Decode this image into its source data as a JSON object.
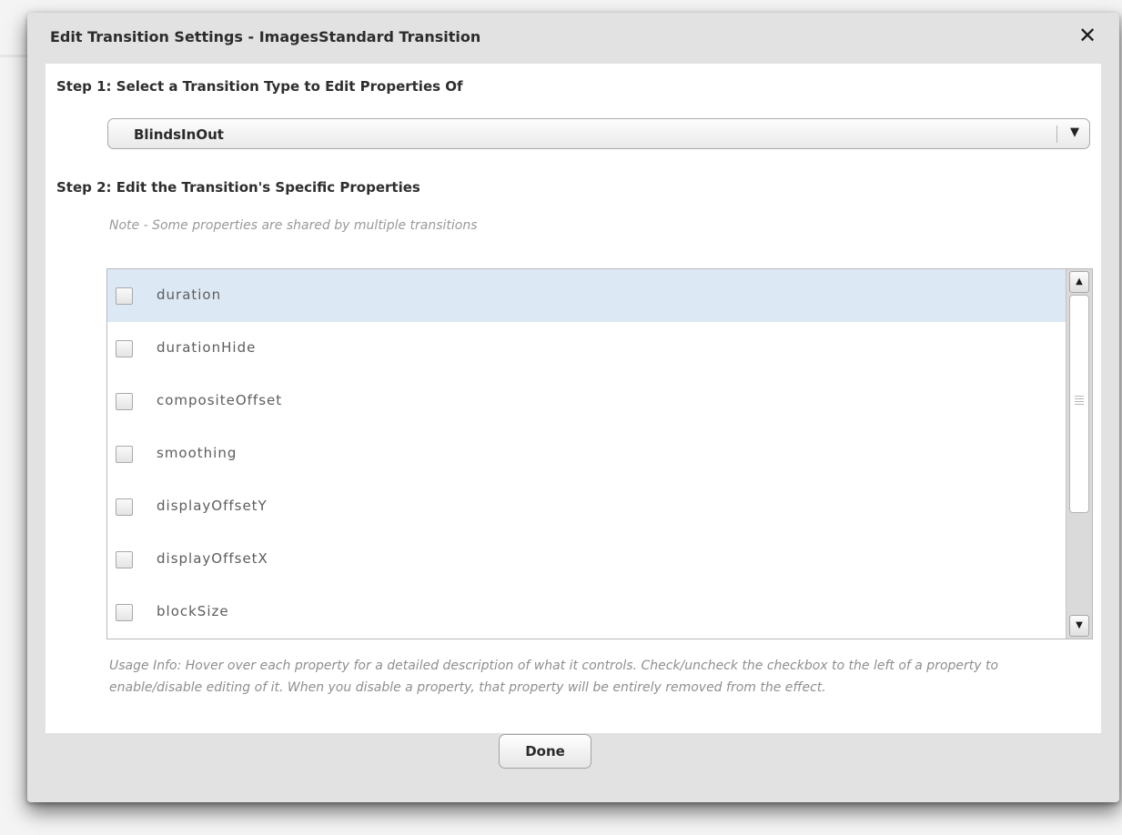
{
  "dialog": {
    "title": "Edit Transition Settings - ImagesStandard Transition",
    "close_icon": "close-icon"
  },
  "step1": {
    "heading": "Step 1: Select a Transition Type to Edit Properties Of",
    "select_value": "BlindsInOut",
    "arrow_icon": "chevron-down-icon"
  },
  "step2": {
    "heading": "Step 2: Edit the Transition's Specific Properties",
    "note": "Note - Some properties are shared by multiple transitions"
  },
  "properties": {
    "items": [
      {
        "label": "duration",
        "checked": false,
        "selected": true
      },
      {
        "label": "durationHide",
        "checked": false,
        "selected": false
      },
      {
        "label": "compositeOffset",
        "checked": false,
        "selected": false
      },
      {
        "label": "smoothing",
        "checked": false,
        "selected": false
      },
      {
        "label": "displayOffsetY",
        "checked": false,
        "selected": false
      },
      {
        "label": "displayOffsetX",
        "checked": false,
        "selected": false
      },
      {
        "label": "blockSize",
        "checked": false,
        "selected": false
      }
    ],
    "scroll_up_icon": "arrow-up-icon",
    "scroll_down_icon": "arrow-down-icon"
  },
  "usage_info": "Usage Info: Hover over each property for a detailed description of what it controls.  Check/uncheck the checkbox to the left of a property to enable/disable editing of it.  When you disable a property, that property will be entirely removed from the effect.",
  "footer": {
    "done_label": "Done"
  },
  "colors": {
    "selected_row": "#dde8f5",
    "dialog_bg": "#e2e2e2",
    "content_bg": "#ffffff"
  }
}
